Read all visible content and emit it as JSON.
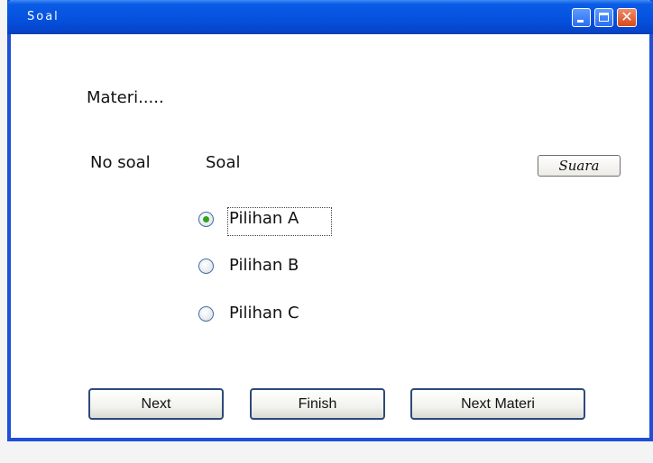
{
  "window": {
    "title": "Soal",
    "controls": {
      "minimize_icon": "minimize-icon",
      "maximize_icon": "maximize-icon",
      "close_label": "✕"
    }
  },
  "content": {
    "materi_label": "Materi.....",
    "no_soal_label": "No soal",
    "soal_label": "Soal",
    "suara_button": "Suara",
    "options": [
      {
        "label": "Pilihan A",
        "selected": true
      },
      {
        "label": "Pilihan B",
        "selected": false
      },
      {
        "label": "Pilihan C",
        "selected": false
      }
    ]
  },
  "footer": {
    "next_label": "Next",
    "finish_label": "Finish",
    "next_materi_label": "Next Materi"
  },
  "colors": {
    "titlebar": "#0553e0",
    "border": "#1f4fd8",
    "close": "#d64a1c",
    "radio_selected": "#2ea31f"
  }
}
